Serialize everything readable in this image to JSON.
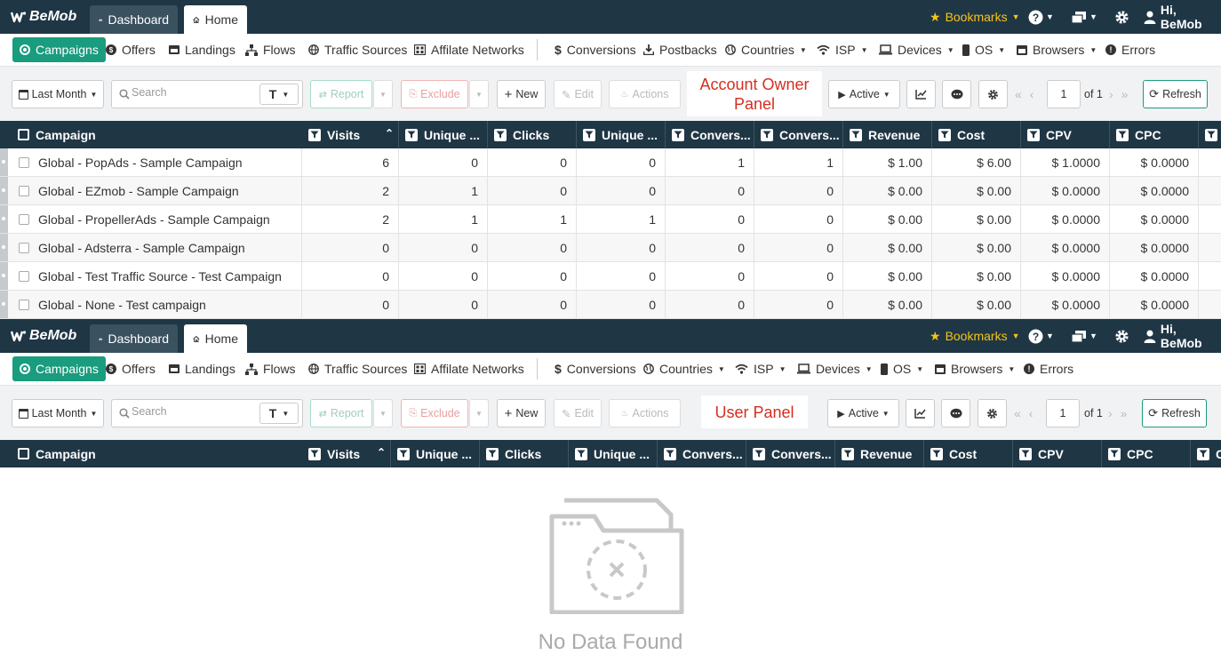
{
  "app": {
    "logo": "BeMob",
    "tabs": {
      "dashboard": "Dashboard",
      "home": "Home"
    },
    "bookmarks": "Bookmarks",
    "greeting": "Hi, BeMob"
  },
  "owner_nav": [
    "Campaigns",
    "Offers",
    "Landings",
    "Flows",
    "Traffic Sources",
    "Affilate Networks",
    "Conversions",
    "Postbacks",
    "Countries",
    "ISP",
    "Devices",
    "OS",
    "Browsers",
    "Errors"
  ],
  "user_nav": [
    "Campaigns",
    "Offers",
    "Landings",
    "Flows",
    "Traffic Sources",
    "Affilate Networks",
    "Conversions",
    "Countries",
    "ISP",
    "Devices",
    "OS",
    "Browsers",
    "Errors"
  ],
  "toolbar": {
    "date_range": "Last Month",
    "search_placeholder": "Search",
    "text_toggle": "T",
    "report": "Report",
    "exclude": "Exclude",
    "new": "New",
    "edit": "Edit",
    "actions": "Actions",
    "status": "Active",
    "page": "1",
    "of": "of 1",
    "refresh": "Refresh"
  },
  "labels": {
    "owner_line1": "Account Owner",
    "owner_line2": "Panel",
    "user": "User Panel"
  },
  "owner_columns": [
    "Campaign",
    "Visits",
    "Unique ...",
    "Clicks",
    "Unique ...",
    "Convers...",
    "Convers...",
    "Revenue",
    "Cost",
    "CPV",
    "CPC",
    ""
  ],
  "user_columns": [
    "Campaign",
    "Visits",
    "Unique ...",
    "Clicks",
    "Unique ...",
    "Convers...",
    "Convers...",
    "Revenue",
    "Cost",
    "CPV",
    "CPC",
    "C"
  ],
  "rows": [
    {
      "name": "Global - PopAds - Sample Campaign",
      "visits": "6",
      "unique_visits": "0",
      "clicks": "0",
      "unique_clicks": "0",
      "conversions": "1",
      "conversions2": "1",
      "revenue": "$ 1.00",
      "cost": "$ 6.00",
      "cpv": "$ 1.0000",
      "cpc": "$ 0.0000"
    },
    {
      "name": "Global - EZmob - Sample Campaign",
      "visits": "2",
      "unique_visits": "1",
      "clicks": "0",
      "unique_clicks": "0",
      "conversions": "0",
      "conversions2": "0",
      "revenue": "$ 0.00",
      "cost": "$ 0.00",
      "cpv": "$ 0.0000",
      "cpc": "$ 0.0000"
    },
    {
      "name": "Global - PropellerAds - Sample Campaign",
      "visits": "2",
      "unique_visits": "1",
      "clicks": "1",
      "unique_clicks": "1",
      "conversions": "0",
      "conversions2": "0",
      "revenue": "$ 0.00",
      "cost": "$ 0.00",
      "cpv": "$ 0.0000",
      "cpc": "$ 0.0000"
    },
    {
      "name": "Global - Adsterra - Sample Campaign",
      "visits": "0",
      "unique_visits": "0",
      "clicks": "0",
      "unique_clicks": "0",
      "conversions": "0",
      "conversions2": "0",
      "revenue": "$ 0.00",
      "cost": "$ 0.00",
      "cpv": "$ 0.0000",
      "cpc": "$ 0.0000"
    },
    {
      "name": "Global - Test Traffic Source - Test Campaign",
      "visits": "0",
      "unique_visits": "0",
      "clicks": "0",
      "unique_clicks": "0",
      "conversions": "0",
      "conversions2": "0",
      "revenue": "$ 0.00",
      "cost": "$ 0.00",
      "cpv": "$ 0.0000",
      "cpc": "$ 0.0000"
    },
    {
      "name": "Global - None - Test campaign",
      "visits": "0",
      "unique_visits": "0",
      "clicks": "0",
      "unique_clicks": "0",
      "conversions": "0",
      "conversions2": "0",
      "revenue": "$ 0.00",
      "cost": "$ 0.00",
      "cpv": "$ 0.0000",
      "cpc": "$ 0.0000"
    }
  ],
  "empty_state": "No Data Found",
  "colors": {
    "header": "#1f3645",
    "accent": "#1a9c7e",
    "bookmark": "#f5c518",
    "panel_label": "#d42e20"
  }
}
